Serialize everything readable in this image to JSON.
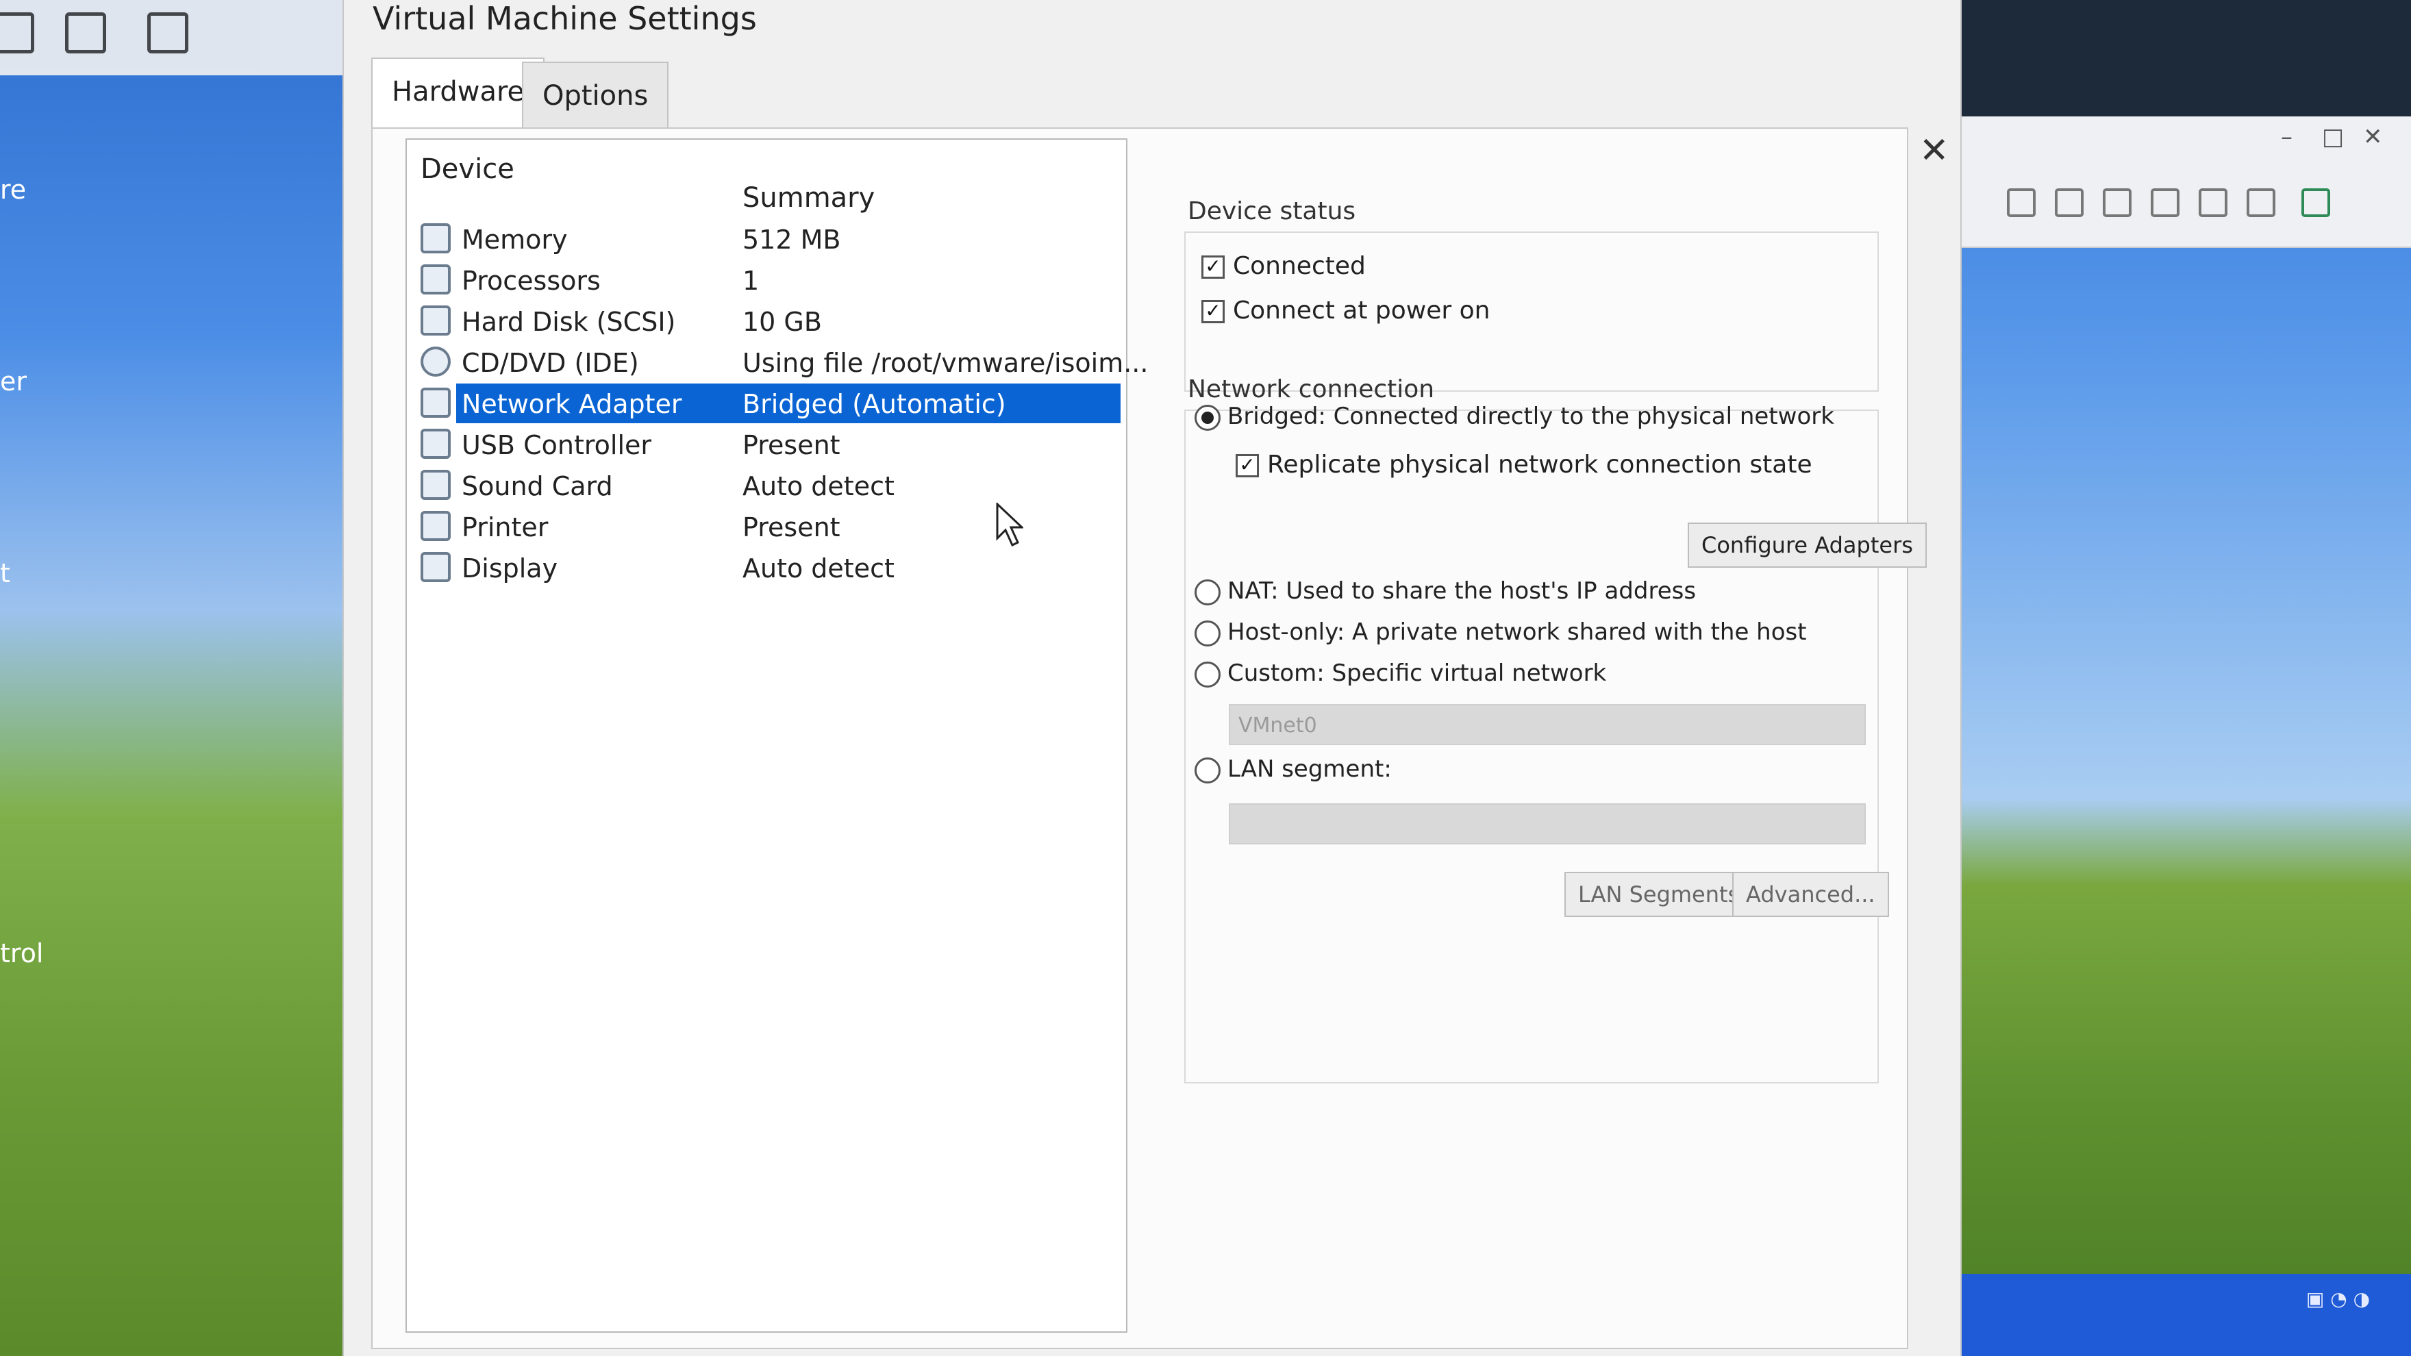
{
  "dialog": {
    "title": "Virtual Machine Settings",
    "tabs": [
      {
        "label": "Hardware",
        "active": true
      },
      {
        "label": "Options",
        "active": false
      }
    ],
    "close_icon": "close-icon"
  },
  "device_list": {
    "headers": {
      "device": "Device",
      "summary": "Summary"
    },
    "rows": [
      {
        "label": "Memory",
        "summary": "512 MB",
        "icon": "memory-icon",
        "selected": false
      },
      {
        "label": "Processors",
        "summary": "1",
        "icon": "processor-icon",
        "selected": false
      },
      {
        "label": "Hard Disk (SCSI)",
        "summary": "10 GB",
        "icon": "hard-disk-icon",
        "selected": false
      },
      {
        "label": "CD/DVD (IDE)",
        "summary": "Using file /root/vmware/isoim...",
        "icon": "cd-dvd-icon",
        "selected": false
      },
      {
        "label": "Network Adapter",
        "summary": "Bridged (Automatic)",
        "icon": "network-adapter-icon",
        "selected": true
      },
      {
        "label": "USB Controller",
        "summary": "Present",
        "icon": "usb-icon",
        "selected": false
      },
      {
        "label": "Sound Card",
        "summary": "Auto detect",
        "icon": "speaker-icon",
        "selected": false
      },
      {
        "label": "Printer",
        "summary": "Present",
        "icon": "printer-icon",
        "selected": false
      },
      {
        "label": "Display",
        "summary": "Auto detect",
        "icon": "display-icon",
        "selected": false
      }
    ]
  },
  "device_status": {
    "label": "Device status",
    "connected": {
      "label": "Connected",
      "checked": true
    },
    "connect_at_power_on": {
      "label": "Connect at power on",
      "checked": true
    }
  },
  "network_connection": {
    "label": "Network connection",
    "bridged": {
      "label": "Bridged: Connected directly to the physical network",
      "selected": true
    },
    "replicate": {
      "label": "Replicate physical network connection state",
      "checked": true
    },
    "configure_adapters": "Configure Adapters",
    "nat": {
      "label": "NAT: Used to share the host's IP address",
      "selected": false
    },
    "host_only": {
      "label": "Host-only: A private network shared with the host",
      "selected": false
    },
    "custom": {
      "label": "Custom: Specific virtual network",
      "selected": false
    },
    "custom_value": "VMnet0",
    "lan_segment": {
      "label": "LAN segment:",
      "selected": false
    },
    "lan_segment_value": "",
    "lan_segments_button": "LAN Segments...",
    "advanced_button": "Advanced..."
  },
  "background": {
    "left_labels": [
      "re",
      "er",
      "t",
      "trol"
    ]
  },
  "colors": {
    "selection": "#0a64d4",
    "dialog_bg": "#f0f0f0"
  }
}
